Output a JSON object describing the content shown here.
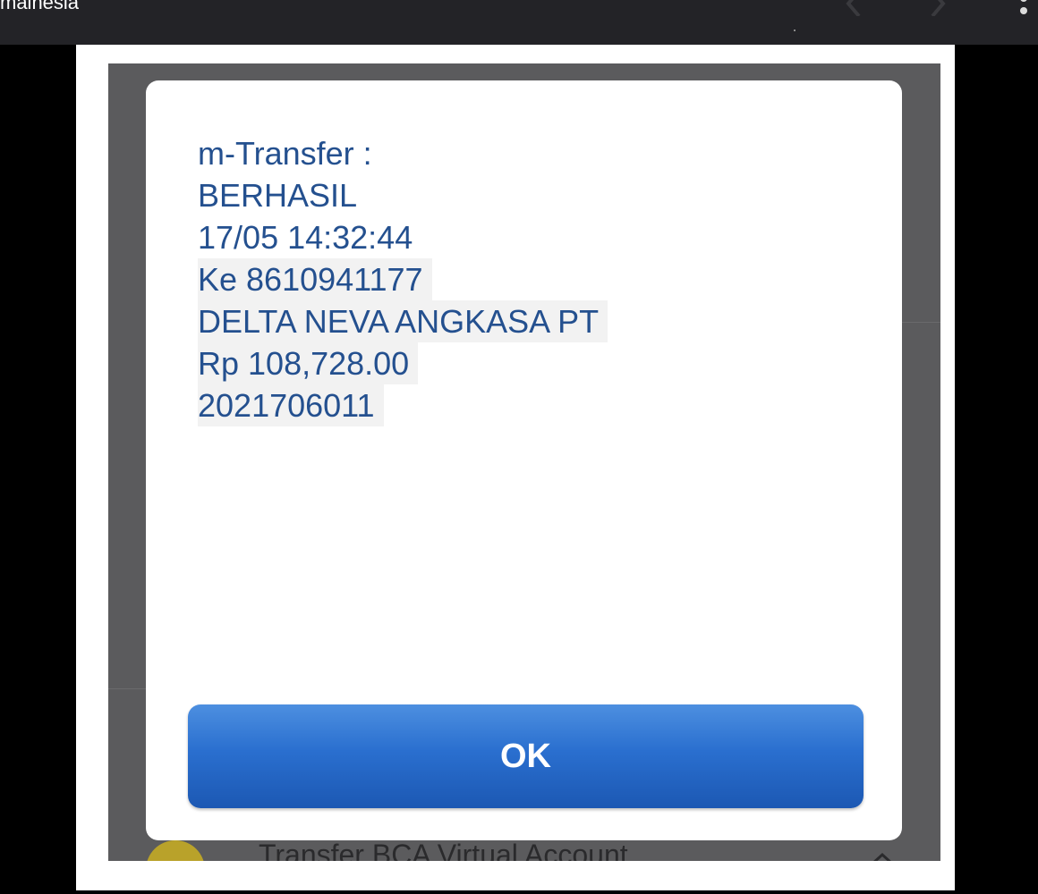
{
  "topbar": {
    "title": "mainesia",
    "prev_icon": "chevron-left-icon",
    "next_icon": "chevron-right-icon",
    "more_icon": "more-vertical-icon"
  },
  "dialog": {
    "lines": [
      "m-Transfer :",
      "BERHASIL",
      "17/05 14:32:44",
      "Ke 8610941177",
      "DELTA NEVA ANGKASA PT",
      "Rp 108,728.00",
      "2021706011"
    ],
    "ok_label": "OK"
  },
  "background": {
    "list_item_label": "Transfer BCA Virtual Account"
  },
  "colors": {
    "text_blue": "#24508f",
    "button_blue": "#2a6fcf",
    "topbar": "#232327"
  }
}
